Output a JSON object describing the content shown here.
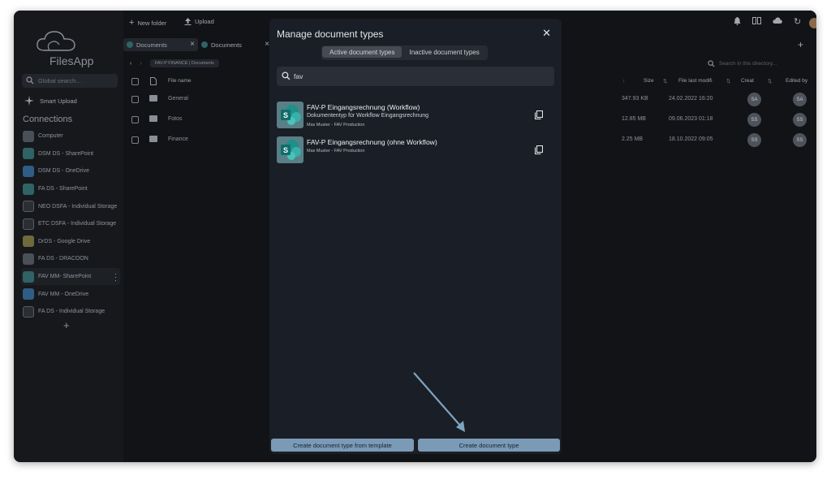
{
  "app": {
    "name": "FilesApp"
  },
  "sidebar": {
    "search_placeholder": "Global search...",
    "smart_upload": "Smart Upload",
    "connections_title": "Connections",
    "connections": [
      {
        "label": "Computer",
        "icon": "computer-icon"
      },
      {
        "label": "DSM DS - SharePoint",
        "icon": "sharepoint-icon"
      },
      {
        "label": "DSM DS - OneDrive",
        "icon": "onedrive-icon"
      },
      {
        "label": "FA DS - SharePoint",
        "icon": "sharepoint-icon"
      },
      {
        "label": "NEO DSFA - Individual Storage",
        "icon": "storage-icon"
      },
      {
        "label": "ETC DSFA - Individual Storage",
        "icon": "storage-icon"
      },
      {
        "label": "DrDS - Google Drive",
        "icon": "google-drive-icon"
      },
      {
        "label": "FA DS - DRACOON",
        "icon": "dracoon-icon"
      },
      {
        "label": "FAV MM- SharePoint",
        "icon": "sharepoint-icon"
      },
      {
        "label": "FAV MM - OneDrive",
        "icon": "onedrive-icon"
      },
      {
        "label": "FA DS - Individual Storage",
        "icon": "storage-icon"
      }
    ]
  },
  "toolbar": {
    "new_folder": "New folder",
    "upload": "Upload"
  },
  "tabs": [
    {
      "label": "Documents"
    },
    {
      "label": "Documents"
    }
  ],
  "breadcrumb": {
    "path": "FAV-P FINANCE | Documents"
  },
  "dir_search_placeholder": "Search in this directory...",
  "table": {
    "headers": {
      "name": "File name",
      "size": "Size",
      "modified": "File last modifi",
      "created": "Creat",
      "edited": "Edited by"
    },
    "rows": [
      {
        "name": "General",
        "size": "347.93 KB",
        "modified": "24.02.2022 16:20",
        "created": "SA",
        "edited": "SA"
      },
      {
        "name": "Fotos",
        "size": "12.85 MB",
        "modified": "09.06.2023 01:18",
        "created": "SS",
        "edited": "SS"
      },
      {
        "name": "Finance",
        "size": "2.25 MB",
        "modified": "18.10.2022 09:05",
        "created": "SS",
        "edited": "SS"
      }
    ]
  },
  "modal": {
    "title": "Manage document types",
    "tabs": {
      "active": "Active document types",
      "inactive": "Inactive document types"
    },
    "search_value": "fav",
    "items": [
      {
        "title": "FAV-P Eingangsrechnung (Workflow)",
        "subtitle": "Dokumententyp für Workflow Eingangsrechnung",
        "meta": "Max Muster - FAV Production"
      },
      {
        "title": "FAV-P Eingangsrechnung (ohne Workflow)",
        "subtitle": "",
        "meta": "Max Muster - FAV Production"
      }
    ],
    "btn_template": "Create document type from template",
    "btn_create": "Create document type"
  },
  "colors": {
    "accent": "#7a9ab6",
    "modal_bg": "#1a1e26",
    "window_bg": "#16181c"
  }
}
